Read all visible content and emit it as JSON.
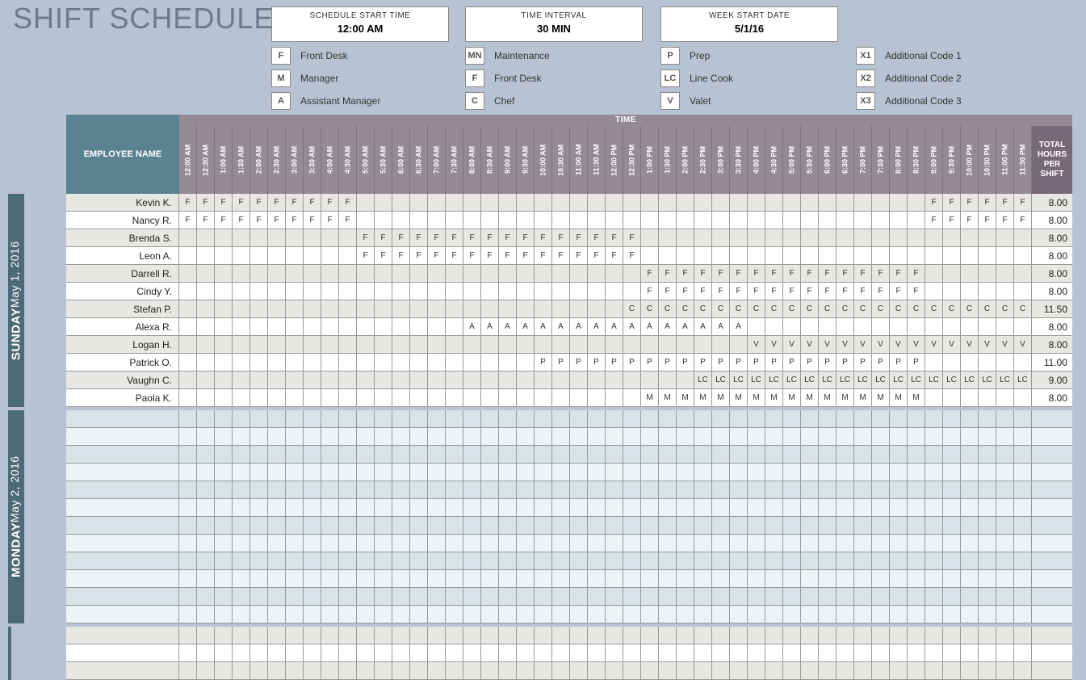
{
  "title": "SHIFT SCHEDULE",
  "config": {
    "start_time": {
      "label": "SCHEDULE START TIME",
      "value": "12:00 AM"
    },
    "interval": {
      "label": "TIME INTERVAL",
      "value": "30 MIN"
    },
    "week_start": {
      "label": "WEEK START DATE",
      "value": "5/1/16"
    }
  },
  "legend": [
    {
      "code": "F",
      "label": "Front Desk"
    },
    {
      "code": "MN",
      "label": "Maintenance"
    },
    {
      "code": "P",
      "label": "Prep"
    },
    {
      "code": "X1",
      "label": "Additional Code 1"
    },
    {
      "code": "M",
      "label": "Manager"
    },
    {
      "code": "F",
      "label": "Front Desk"
    },
    {
      "code": "LC",
      "label": "Line Cook"
    },
    {
      "code": "X2",
      "label": "Additional Code 2"
    },
    {
      "code": "A",
      "label": "Assistant Manager"
    },
    {
      "code": "C",
      "label": "Chef"
    },
    {
      "code": "V",
      "label": "Valet"
    },
    {
      "code": "X3",
      "label": "Additional Code 3"
    }
  ],
  "headers": {
    "employee": "EMPLOYEE NAME",
    "time_bar": "TIME",
    "total": "TOTAL HOURS PER SHIFT"
  },
  "time_slots": [
    "12:00 AM",
    "12:30 AM",
    "1:00 AM",
    "1:30 AM",
    "2:00 AM",
    "2:30 AM",
    "3:00 AM",
    "3:30 AM",
    "4:00 AM",
    "4:30 AM",
    "5:00 AM",
    "5:30 AM",
    "6:00 AM",
    "6:30 AM",
    "7:00 AM",
    "7:30 AM",
    "8:00 AM",
    "8:30 AM",
    "9:00 AM",
    "9:30 AM",
    "10:00 AM",
    "10:30 AM",
    "11:00 AM",
    "11:30 AM",
    "12:00 PM",
    "12:30 PM",
    "1:00 PM",
    "1:30 PM",
    "2:00 PM",
    "2:30 PM",
    "3:00 PM",
    "3:30 PM",
    "4:00 PM",
    "4:30 PM",
    "5:00 PM",
    "5:30 PM",
    "6:00 PM",
    "6:30 PM",
    "7:00 PM",
    "7:30 PM",
    "8:00 PM",
    "8:30 PM",
    "9:00 PM",
    "9:30 PM",
    "10:00 PM",
    "10:30 PM",
    "11:00 PM",
    "11:30 PM"
  ],
  "days": [
    {
      "name": "SUNDAY",
      "date": "May 1, 2016",
      "style": "sun",
      "rows": 12,
      "employees": [
        {
          "name": "Kevin K.",
          "total": "8.00",
          "shifts": [
            {
              "code": "F",
              "start": 0,
              "end": 9
            },
            {
              "code": "F",
              "start": 42,
              "end": 47
            }
          ]
        },
        {
          "name": "Nancy R.",
          "total": "8.00",
          "shifts": [
            {
              "code": "F",
              "start": 0,
              "end": 9
            },
            {
              "code": "F",
              "start": 42,
              "end": 47
            }
          ]
        },
        {
          "name": "Brenda S.",
          "total": "8.00",
          "shifts": [
            {
              "code": "F",
              "start": 10,
              "end": 25
            }
          ]
        },
        {
          "name": "Leon A.",
          "total": "8.00",
          "shifts": [
            {
              "code": "F",
              "start": 10,
              "end": 25
            }
          ]
        },
        {
          "name": "Darrell R.",
          "total": "8.00",
          "shifts": [
            {
              "code": "F",
              "start": 26,
              "end": 41
            }
          ]
        },
        {
          "name": "Cindy Y.",
          "total": "8.00",
          "shifts": [
            {
              "code": "F",
              "start": 26,
              "end": 41
            }
          ]
        },
        {
          "name": "Stefan P.",
          "total": "11.50",
          "shifts": [
            {
              "code": "C",
              "start": 25,
              "end": 47
            }
          ]
        },
        {
          "name": "Alexa R.",
          "total": "8.00",
          "shifts": [
            {
              "code": "A",
              "start": 16,
              "end": 31
            }
          ]
        },
        {
          "name": "Logan H.",
          "total": "8.00",
          "shifts": [
            {
              "code": "V",
              "start": 32,
              "end": 47
            }
          ]
        },
        {
          "name": "Patrick O.",
          "total": "11.00",
          "shifts": [
            {
              "code": "P",
              "start": 20,
              "end": 41
            }
          ]
        },
        {
          "name": "Vaughn C.",
          "total": "9.00",
          "shifts": [
            {
              "code": "LC",
              "start": 29,
              "end": 47
            }
          ]
        },
        {
          "name": "Paola K.",
          "total": "8.00",
          "shifts": [
            {
              "code": "M",
              "start": 26,
              "end": 41
            }
          ]
        }
      ]
    },
    {
      "name": "MONDAY",
      "date": "May 2, 2016",
      "style": "mon",
      "rows": 12,
      "employees": [
        {
          "name": "",
          "total": "",
          "shifts": []
        },
        {
          "name": "",
          "total": "",
          "shifts": []
        },
        {
          "name": "",
          "total": "",
          "shifts": []
        },
        {
          "name": "",
          "total": "",
          "shifts": []
        },
        {
          "name": "",
          "total": "",
          "shifts": []
        },
        {
          "name": "",
          "total": "",
          "shifts": []
        },
        {
          "name": "",
          "total": "",
          "shifts": []
        },
        {
          "name": "",
          "total": "",
          "shifts": []
        },
        {
          "name": "",
          "total": "",
          "shifts": []
        },
        {
          "name": "",
          "total": "",
          "shifts": []
        },
        {
          "name": "",
          "total": "",
          "shifts": []
        },
        {
          "name": "",
          "total": "",
          "shifts": []
        }
      ]
    },
    {
      "name": "",
      "date": "",
      "style": "tue",
      "rows": 3,
      "employees": [
        {
          "name": "",
          "total": "",
          "shifts": []
        },
        {
          "name": "",
          "total": "",
          "shifts": []
        },
        {
          "name": "",
          "total": "",
          "shifts": []
        }
      ]
    }
  ]
}
